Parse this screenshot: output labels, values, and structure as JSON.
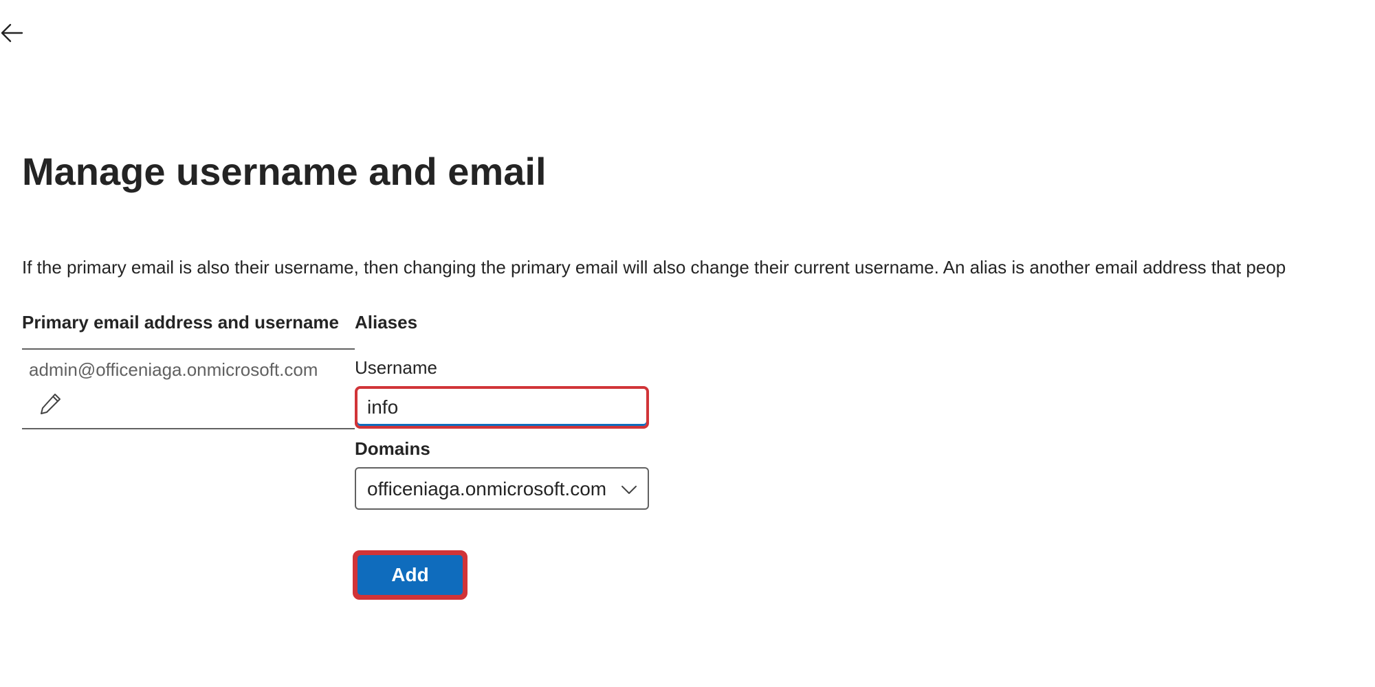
{
  "header": {
    "back_icon": "arrow-left-icon"
  },
  "page": {
    "title": "Manage username and email",
    "description": "If the primary email is also their username, then changing the primary email will also change their current username. An alias is another email address that peop"
  },
  "table": {
    "primary_header": "Primary email address and username",
    "aliases_header": "Aliases",
    "primary_email": "admin@officeniaga.onmicrosoft.com",
    "edit_icon": "pencil-icon"
  },
  "alias_form": {
    "username_label": "Username",
    "username_value": "info",
    "domains_label": "Domains",
    "domain_value": "officeniaga.onmicrosoft.com",
    "domain_icon": "chevron-down-icon",
    "add_label": "Add"
  },
  "colors": {
    "accent": "#0f6cbd",
    "highlight": "#d13438",
    "text": "#242424",
    "muted_text": "#616161"
  }
}
